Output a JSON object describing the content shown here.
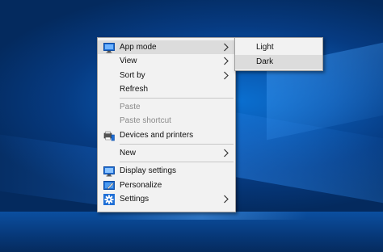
{
  "context_menu": {
    "items": [
      {
        "label": "App mode",
        "icon": "monitor-icon",
        "has_submenu": true,
        "state": "hover"
      },
      {
        "label": "View",
        "has_submenu": true
      },
      {
        "label": "Sort by",
        "has_submenu": true
      },
      {
        "label": "Refresh"
      },
      {
        "label": "Paste",
        "state": "disabled"
      },
      {
        "label": "Paste shortcut",
        "state": "disabled"
      },
      {
        "label": "Devices and printers",
        "icon": "devices-printers-icon"
      },
      {
        "label": "New",
        "has_submenu": true
      },
      {
        "label": "Display settings",
        "icon": "display-icon"
      },
      {
        "label": "Personalize",
        "icon": "personalize-icon"
      },
      {
        "label": "Settings",
        "icon": "gear-icon",
        "has_submenu": true
      }
    ]
  },
  "app_mode_submenu": {
    "items": [
      {
        "label": "Light"
      },
      {
        "label": "Dark",
        "state": "hover"
      }
    ]
  },
  "colors": {
    "menu_bg": "#f2f2f2",
    "hover_bg": "#dcdcdc",
    "disabled_text": "#8a8a8a",
    "icon_blue": "#1f6fd6",
    "desktop_blue": "#0a56ad"
  }
}
